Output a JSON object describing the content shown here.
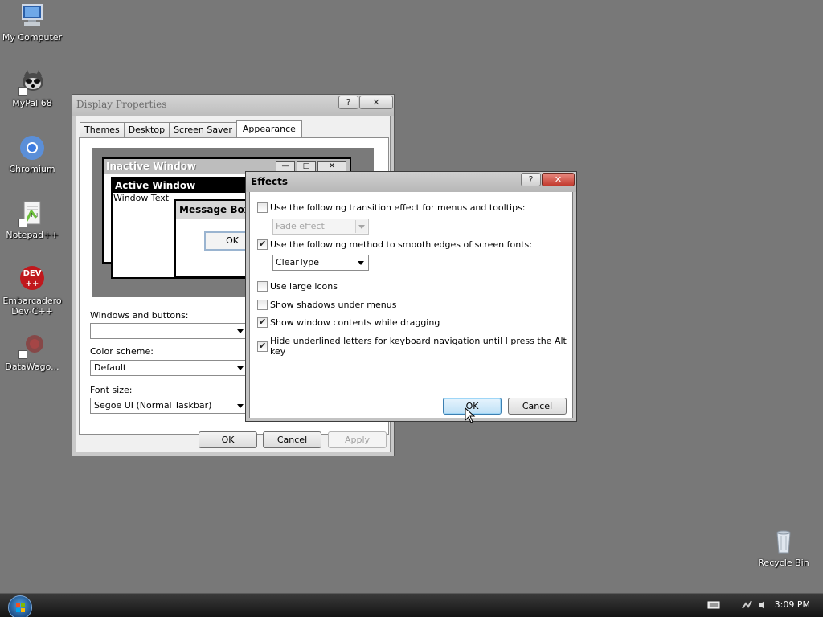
{
  "desktop": {
    "icons": [
      {
        "label": "My Computer",
        "icon": "computer-icon"
      },
      {
        "label": "MyPal 68",
        "icon": "raccoon-icon"
      },
      {
        "label": "Chromium",
        "icon": "chromium-icon"
      },
      {
        "label": "Notepad++",
        "icon": "notepadpp-icon"
      },
      {
        "label": "Embarcadero\nDev-C++",
        "icon": "devcpp-icon"
      },
      {
        "label": "DataWago...",
        "icon": "datawagon-icon"
      },
      {
        "label": "Recycle Bin",
        "icon": "recycle-bin-icon"
      }
    ],
    "devcpp_badge": "DEV",
    "devcpp_plus": "++"
  },
  "display_properties": {
    "title": "Display Properties",
    "help_btn": "?",
    "tabs": [
      "Themes",
      "Desktop",
      "Screen Saver",
      "Appearance"
    ],
    "active_tab": "Appearance",
    "preview": {
      "inactive_title": "Inactive Window",
      "active_title": "Active Window",
      "window_text": "Window Text",
      "message_box_title": "Message Box",
      "ok_label": "OK"
    },
    "windows_and_buttons_label": "Windows and buttons:",
    "windows_and_buttons_value": "",
    "color_scheme_label": "Color scheme:",
    "color_scheme_value": "Default",
    "font_size_label": "Font size:",
    "font_size_value": "Segoe UI (Normal Taskbar)",
    "ok": "OK",
    "cancel": "Cancel",
    "apply": "Apply"
  },
  "effects": {
    "title": "Effects",
    "help_btn": "?",
    "options": [
      {
        "label": "Use the following transition effect for menus and tooltips:",
        "checked": false
      },
      {
        "label": "Use the following method to smooth edges of screen fonts:",
        "checked": true
      },
      {
        "label": "Use large icons",
        "checked": false
      },
      {
        "label": "Show shadows under menus",
        "checked": false
      },
      {
        "label": "Show window contents while dragging",
        "checked": true
      },
      {
        "label": "Hide underlined letters for keyboard navigation until I press the Alt key",
        "checked": true
      }
    ],
    "transition_value": "Fade effect",
    "smoothing_value": "ClearType",
    "ok": "OK",
    "cancel": "Cancel"
  },
  "taskbar": {
    "clock": "3:09 PM"
  },
  "colors": {
    "desktop": "#787878",
    "focus_button": "#bfe0f6",
    "close_button": "#c23a2e"
  }
}
